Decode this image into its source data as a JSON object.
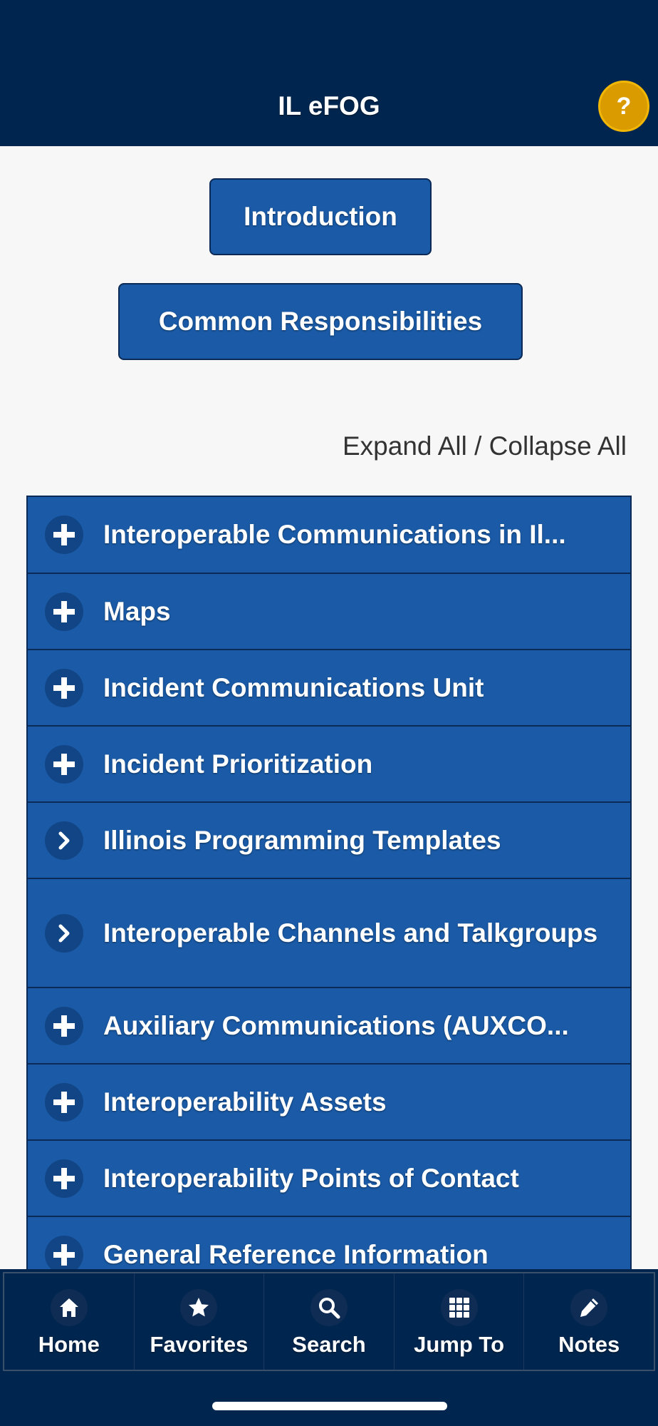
{
  "header": {
    "title": "IL eFOG",
    "help_label": "?"
  },
  "buttons": {
    "introduction": "Introduction",
    "common_responsibilities": "Common Responsibilities"
  },
  "expand_collapse": "Expand All / Collapse All",
  "sections": [
    {
      "label": "Interoperable Communications in Il...",
      "icon": "plus-icon"
    },
    {
      "label": "Maps",
      "icon": "plus-icon"
    },
    {
      "label": "Incident Communications Unit",
      "icon": "plus-icon"
    },
    {
      "label": "Incident Prioritization",
      "icon": "plus-icon"
    },
    {
      "label": "Illinois Programming Templates",
      "icon": "chevron-right-icon"
    },
    {
      "label": "Interoperable Channels and Talkgroups",
      "icon": "chevron-right-icon"
    },
    {
      "label": "Auxiliary Communications (AUXCO...",
      "icon": "plus-icon"
    },
    {
      "label": "Interoperability Assets",
      "icon": "plus-icon"
    },
    {
      "label": "Interoperability Points of Contact",
      "icon": "plus-icon"
    },
    {
      "label": "General Reference Information",
      "icon": "plus-icon"
    }
  ],
  "nav": [
    {
      "label": "Home",
      "icon": "home-icon"
    },
    {
      "label": "Favorites",
      "icon": "star-icon"
    },
    {
      "label": "Search",
      "icon": "search-icon"
    },
    {
      "label": "Jump To",
      "icon": "grid-icon"
    },
    {
      "label": "Notes",
      "icon": "pencil-icon"
    }
  ],
  "colors": {
    "header_bg": "#00264f",
    "button_bg": "#1a5aa6",
    "help_bg": "#d99b00"
  }
}
